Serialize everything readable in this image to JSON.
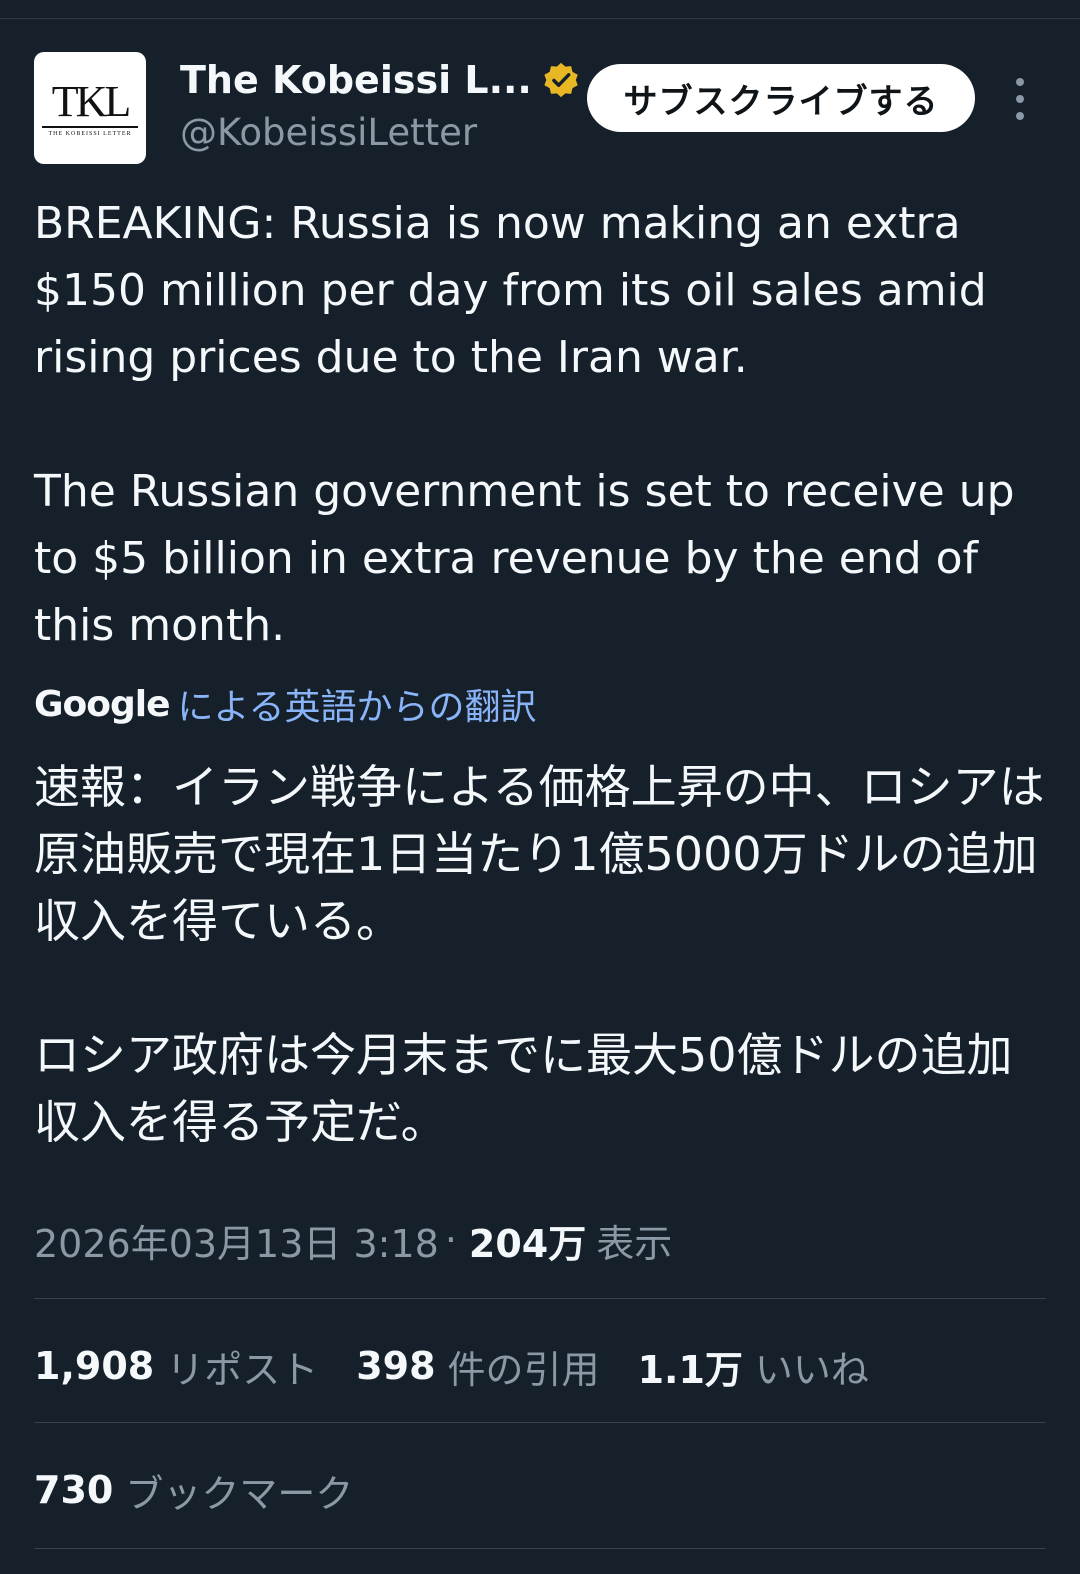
{
  "author": {
    "display_name": "The Kobeissi L...",
    "handle": "@KobeissiLetter",
    "avatar_text": "TKL",
    "avatar_subtext": "THE KOBEISSI LETTER",
    "verified_badge_color": "#e8b824"
  },
  "actions": {
    "subscribe_label": "サブスクライブする"
  },
  "tweet": {
    "text_en": "BREAKING: Russia is now making an extra $150 million per day from its oil sales amid rising prices due to the Iran war.\n\nThe Russian government is set to receive up to $5 billion in extra revenue by the end of this month.",
    "translation_provider": "Google",
    "translation_label": "による英語からの翻訳",
    "text_ja": "速報：イラン戦争による価格上昇の中、ロシアは原油販売で現在1日当たり1億5000万ドルの追加収入を得ている。\n\nロシア政府は今月末までに最大50億ドルの追加収入を得る予定だ。"
  },
  "meta": {
    "timestamp": "2026年03月13日 3:18",
    "separator": "·",
    "views_count": "204万",
    "views_label": "表示"
  },
  "stats": {
    "reposts_count": "1,908",
    "reposts_label": "リポスト",
    "quotes_count": "398",
    "quotes_label": "件の引用",
    "likes_count": "1.1万",
    "likes_label": "いいね",
    "bookmarks_count": "730",
    "bookmarks_label": "ブックマーク"
  },
  "colors": {
    "background": "#15202b",
    "text_primary": "#f5f8fa",
    "text_secondary": "#8b98a5",
    "link": "#8ab4f8"
  }
}
